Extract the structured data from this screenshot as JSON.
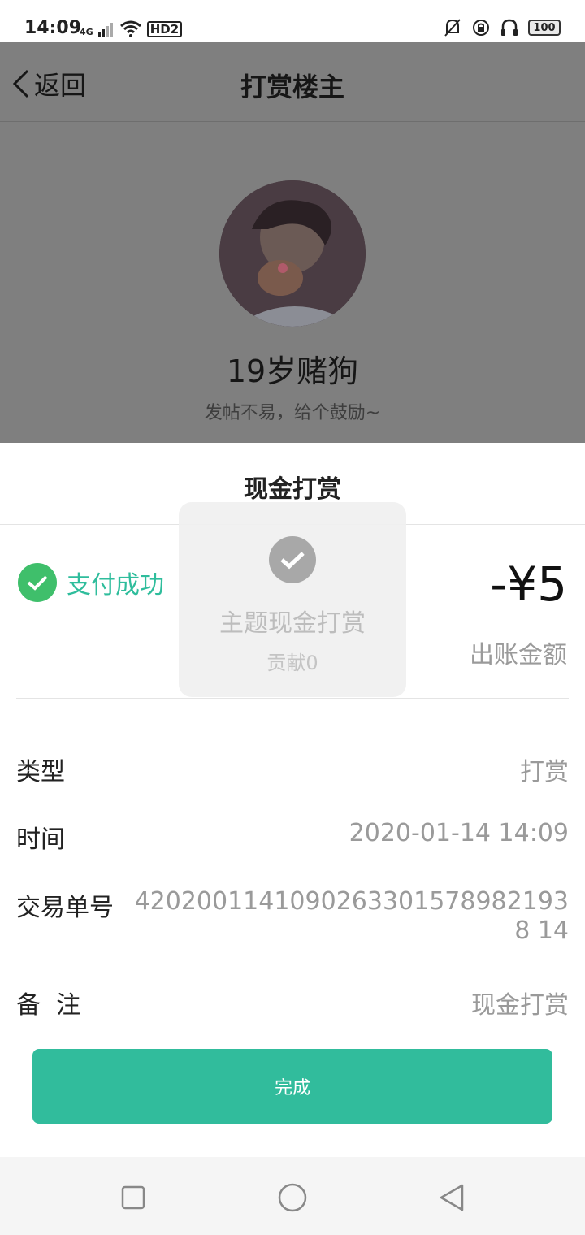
{
  "status_bar": {
    "time": "14:09",
    "network": "4G",
    "hd_label": "HD2",
    "battery": "100"
  },
  "header": {
    "back_label": "返回",
    "title": "打赏楼主"
  },
  "profile": {
    "username": "19岁赌狗",
    "tagline": "发帖不易，给个鼓励~"
  },
  "sheet": {
    "title": "现金打赏",
    "status_text": "支付成功",
    "amount": "-¥5",
    "amount_label": "出账金额",
    "rows": [
      {
        "label": "类型",
        "value": "打赏"
      },
      {
        "label": "时间",
        "value": "2020-01-14 14:09"
      },
      {
        "label": "交易单号",
        "value": "42020011410902633015789821938 14"
      },
      {
        "label": "备  注",
        "value": "现金打赏"
      }
    ],
    "done_label": "完成"
  },
  "toast": {
    "title": "主题现金打赏",
    "subtitle": "贡献0"
  },
  "colors": {
    "accent": "#31bc9c",
    "success": "#3fbf6b",
    "overlay": "#7f7f7f"
  }
}
